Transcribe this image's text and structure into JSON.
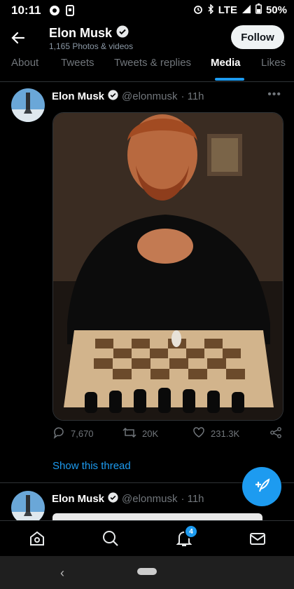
{
  "status_bar": {
    "time": "10:11",
    "network": "LTE",
    "battery": "50%",
    "icons": [
      "notification-icon",
      "photo-icon",
      "alarm-icon",
      "bluetooth-icon",
      "signal-icon",
      "battery-icon"
    ]
  },
  "header": {
    "name": "Elon Musk",
    "verified": true,
    "subtitle": "1,165 Photos & videos",
    "follow_label": "Follow"
  },
  "tabs": [
    {
      "label": "About",
      "active": false
    },
    {
      "label": "Tweets",
      "active": false
    },
    {
      "label": "Tweets & replies",
      "active": false
    },
    {
      "label": "Media",
      "active": true
    },
    {
      "label": "Likes",
      "active": false
    }
  ],
  "tweets": [
    {
      "name": "Elon Musk",
      "handle": "@elonmusk",
      "time": "· 11h",
      "replies": "7,670",
      "retweets": "20K",
      "likes": "231.3K",
      "show_thread": "Show this thread"
    },
    {
      "name": "Elon Musk",
      "handle": "@elonmusk",
      "time": "· 11h"
    }
  ],
  "bottom_nav": {
    "notification_count": "4",
    "items": [
      "home-icon",
      "search-icon",
      "notifications-icon",
      "messages-icon"
    ]
  },
  "colors": {
    "accent": "#1d9bf0",
    "background": "#000000",
    "muted": "#71767b"
  }
}
